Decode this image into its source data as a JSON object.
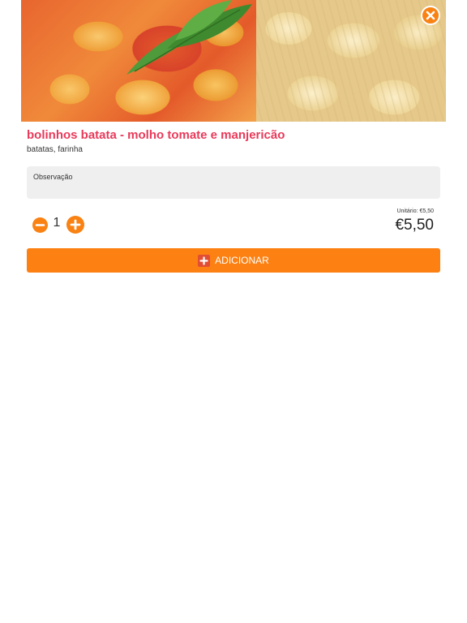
{
  "product": {
    "name": "bolinhos batata - molho tomate e manjericão",
    "ingredients": "batatas, farinha",
    "image": {
      "left": "tomato-sauce-gnocchi-with-basil",
      "right": "raw-potato-gnocchi"
    }
  },
  "observation": {
    "placeholder": "Observação",
    "value": ""
  },
  "quantity": {
    "value": "1"
  },
  "price": {
    "unit_text": "Unitário: €5,50",
    "total": "€5,50"
  },
  "add_button": {
    "label": "ADICIONAR",
    "icon": "plus-square-icon"
  },
  "icons": {
    "close": "close-circle-icon",
    "minus": "minus-circle-icon",
    "plus": "plus-circle-icon"
  },
  "colors": {
    "accent": "#f98213",
    "title": "#e83a5a",
    "field_bg": "#efefef"
  }
}
